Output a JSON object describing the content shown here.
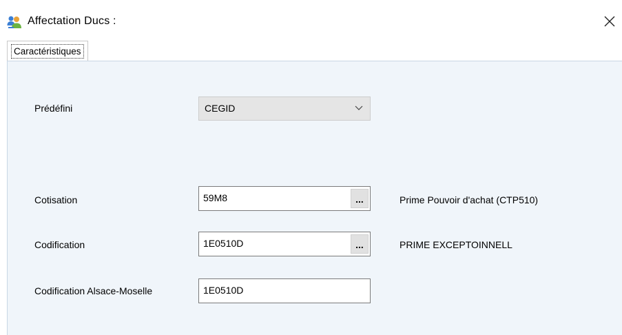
{
  "window": {
    "title": "Affectation Ducs :",
    "app_icon": "users-icon",
    "close_icon": "close-icon"
  },
  "tabs": [
    {
      "label": "Caractéristiques",
      "active": true
    }
  ],
  "form": {
    "predefini": {
      "label": "Prédéfini",
      "value": "CEGID"
    },
    "cotisation": {
      "label": "Cotisation",
      "value": "59M8",
      "button": "...",
      "description": "Prime Pouvoir d'achat (CTP510)"
    },
    "codification": {
      "label": "Codification",
      "value": "1E0510D",
      "button": "...",
      "description": "PRIME EXCEPTOINNELL"
    },
    "codification_am": {
      "label": "Codification Alsace-Moselle",
      "value": "1E0510D"
    }
  }
}
